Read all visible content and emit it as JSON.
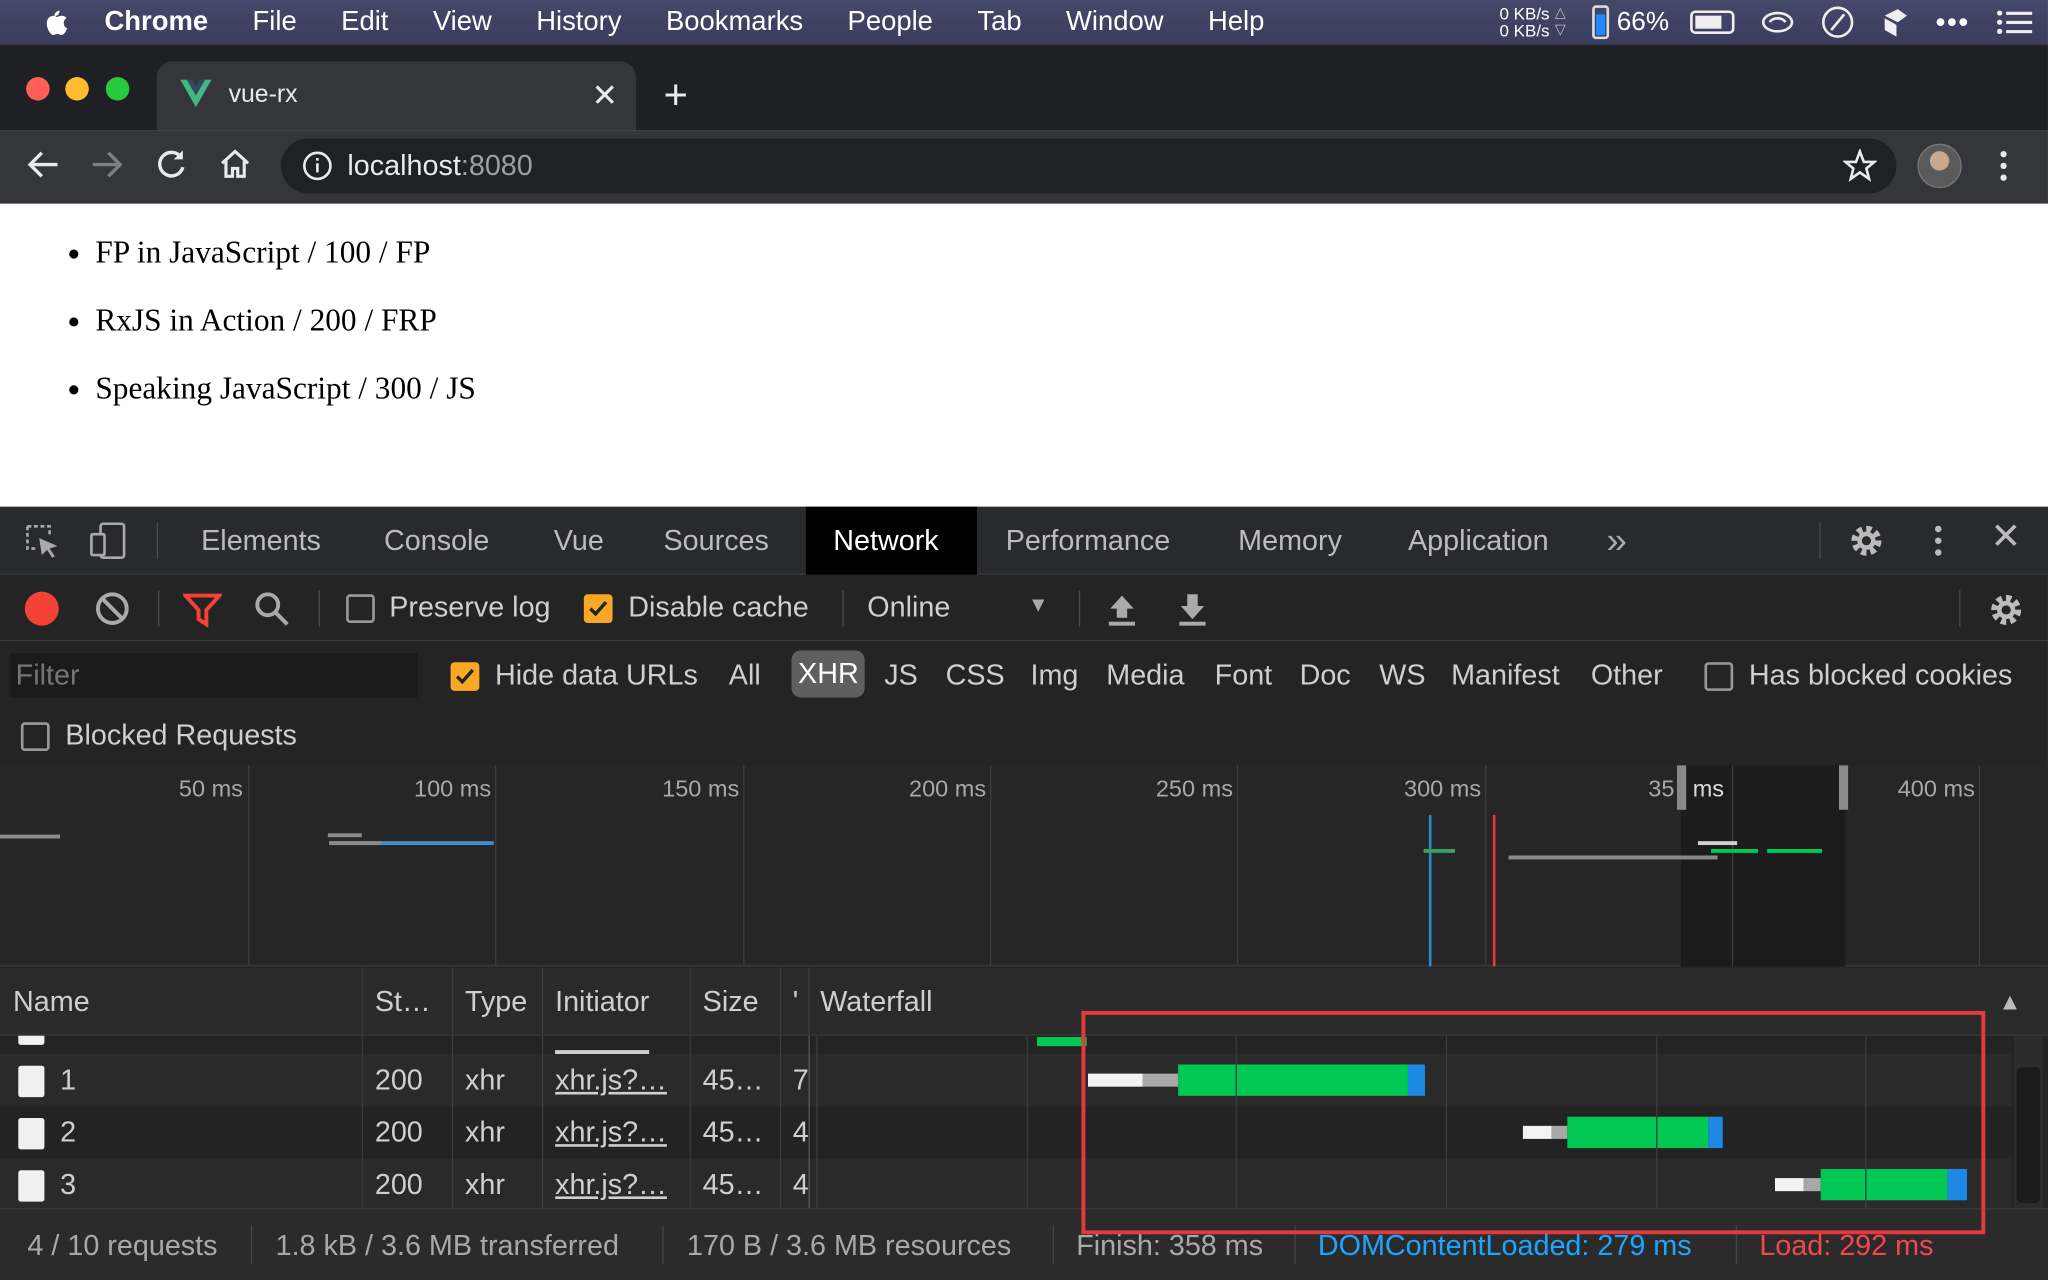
{
  "menubar": {
    "app": "Chrome",
    "items": [
      "File",
      "Edit",
      "View",
      "History",
      "Bookmarks",
      "People",
      "Tab",
      "Window",
      "Help"
    ],
    "net_up": "0 KB/s",
    "net_down": "0 KB/s",
    "battery": "66%"
  },
  "browser": {
    "tab_title": "vue-rx",
    "url_host": "localhost",
    "url_port": ":8080"
  },
  "page": {
    "items": [
      "FP in JavaScript / 100 / FP",
      "RxJS in Action / 200 / FRP",
      "Speaking JavaScript / 300 / JS"
    ]
  },
  "devtools": {
    "tabs": [
      "Elements",
      "Console",
      "Vue",
      "Sources",
      "Network",
      "Performance",
      "Memory",
      "Application"
    ],
    "active_tab": "Network",
    "toolbar": {
      "preserve_log": "Preserve log",
      "disable_cache": "Disable cache",
      "throttle": "Online"
    },
    "filter": {
      "placeholder": "Filter",
      "hide_data_urls": "Hide data URLs",
      "types": [
        "All",
        "XHR",
        "JS",
        "CSS",
        "Img",
        "Media",
        "Font",
        "Doc",
        "WS",
        "Manifest",
        "Other"
      ],
      "active_type": "XHR",
      "has_blocked_cookies": "Has blocked cookies",
      "blocked_requests": "Blocked Requests"
    },
    "overview_ticks": [
      "50 ms",
      "100 ms",
      "150 ms",
      "200 ms",
      "250 ms",
      "300 ms",
      "35",
      "ms",
      "400 ms"
    ],
    "columns": {
      "name": "Name",
      "status": "St…",
      "type": "Type",
      "initiator": "Initiator",
      "size": "Size",
      "time": "'",
      "waterfall": "Waterfall"
    },
    "rows": [
      {
        "name": "1",
        "status": "200",
        "type": "xhr",
        "initiator": "xhr.js?…",
        "size": "45…",
        "time": "7"
      },
      {
        "name": "2",
        "status": "200",
        "type": "xhr",
        "initiator": "xhr.js?…",
        "size": "45…",
        "time": "4"
      },
      {
        "name": "3",
        "status": "200",
        "type": "xhr",
        "initiator": "xhr.js?…",
        "size": "45…",
        "time": "4"
      }
    ],
    "status": {
      "requests": "4 / 10 requests",
      "transferred": "1.8 kB / 3.6 MB transferred",
      "resources": "170 B / 3.6 MB resources",
      "finish": "Finish: 358 ms",
      "dcl": "DOMContentLoaded: 279 ms",
      "load": "Load: 292 ms"
    },
    "colors": {
      "dcl": "#1ea5ff",
      "load": "#f1474d",
      "highlight": "#e5393e",
      "green": "#00c853"
    }
  }
}
